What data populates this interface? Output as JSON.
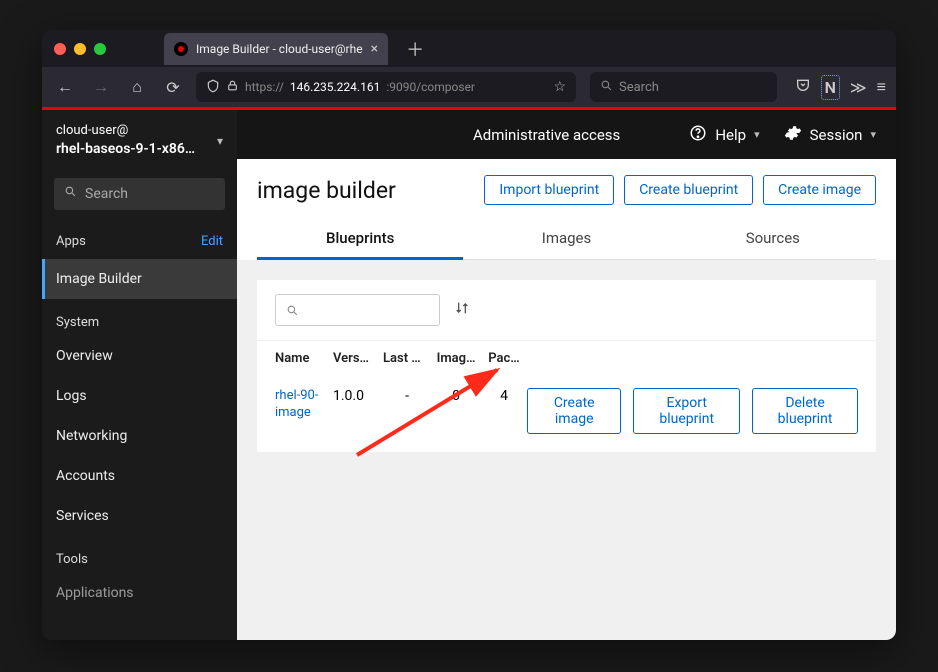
{
  "browser": {
    "tab_title": "Image Builder - cloud-user@rhe",
    "url_display": "146.235.224.161",
    "url_suffix": ":9090/composer",
    "url_prefix": "https://",
    "search_placeholder": "Search"
  },
  "sidebar": {
    "user_line": "cloud-user@",
    "host_line": "rhel-baseos-9-1-x86…",
    "search_placeholder": "Search",
    "apps_label": "Apps",
    "edit_label": "Edit",
    "system_label": "System",
    "tools_label": "Tools",
    "items": {
      "image_builder": "Image Builder",
      "overview": "Overview",
      "logs": "Logs",
      "networking": "Networking",
      "accounts": "Accounts",
      "services": "Services",
      "applications": "Applications"
    }
  },
  "topbar": {
    "admin_access": "Administrative access",
    "help": "Help",
    "session": "Session"
  },
  "page": {
    "title": "image builder",
    "actions": {
      "import": "Import blueprint",
      "create_blueprint": "Create blueprint",
      "create_image": "Create image"
    },
    "tabs": {
      "blueprints": "Blueprints",
      "images": "Images",
      "sources": "Sources"
    }
  },
  "table": {
    "headers": {
      "name": "Name",
      "version": "Vers…",
      "last": "Last …",
      "images": "Imag…",
      "packages": "Pac…"
    },
    "row": {
      "name": "rhel-90-image",
      "version": "1.0.0",
      "last": "-",
      "images": "0",
      "packages": "4"
    },
    "row_actions": {
      "create_image": "Create image",
      "export": "Export blueprint",
      "delete": "Delete blueprint"
    }
  }
}
